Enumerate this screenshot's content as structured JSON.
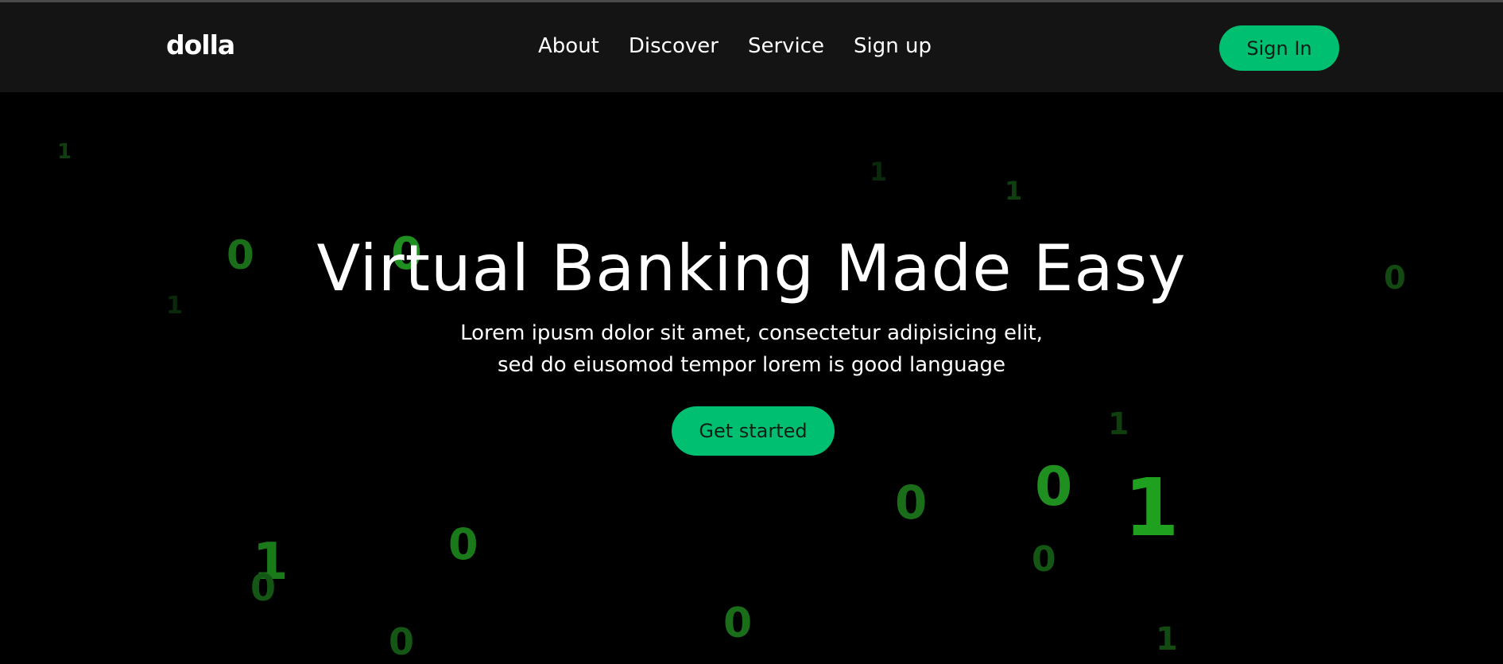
{
  "navbar": {
    "logo": "dolla",
    "links": [
      "About",
      "Discover",
      "Service",
      "Sign up"
    ],
    "sign_in_label": "Sign In"
  },
  "hero": {
    "title": "Virtual Banking Made Easy",
    "subtitle_line1": "Lorem ipusm dolor sit amet, consectetur adipisicing elit,",
    "subtitle_line2": "sed do eiusomod tempor lorem is good language",
    "cta_label": "Get started"
  },
  "background_digits": [
    "1",
    "0",
    "0",
    "1",
    "1",
    "1",
    "0",
    "1",
    "0",
    "0",
    "1",
    "0",
    "0",
    "1",
    "0",
    "0",
    "0",
    "1"
  ],
  "colors": {
    "accent": "#01bf71",
    "navbar_bg": "#141414",
    "hero_bg": "#000000",
    "digit_bright": "#1f8f1f",
    "digit_dim": "#0f3f0f"
  }
}
